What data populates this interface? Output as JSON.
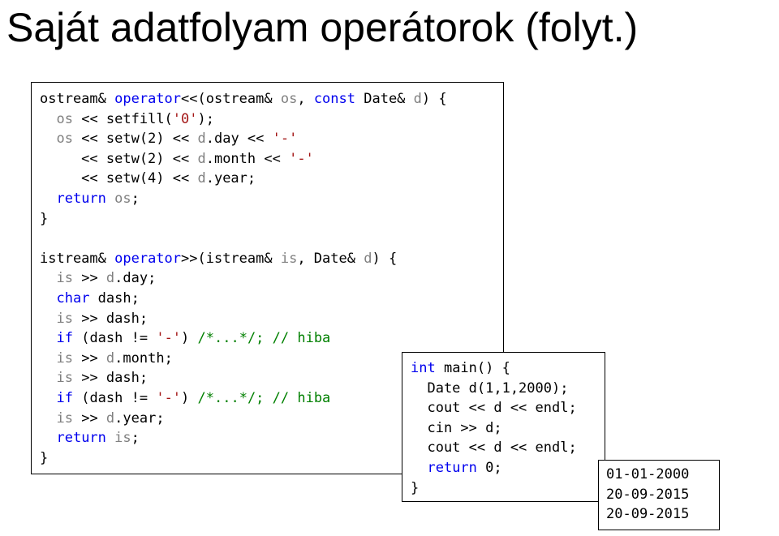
{
  "title": "Saját adatfolyam operátorok (folyt.)",
  "colors": {
    "keyword": "#0000ee",
    "parameter": "#808080",
    "string": "#a31515",
    "comment": "#008000",
    "text": "#000000"
  },
  "operators_code": [
    [
      {
        "t": "ostream& "
      },
      {
        "t": "operator",
        "c": "kw"
      },
      {
        "t": "<<(ostream& "
      },
      {
        "t": "os",
        "c": "param"
      },
      {
        "t": ", "
      },
      {
        "t": "const",
        "c": "kw"
      },
      {
        "t": " Date& "
      },
      {
        "t": "d",
        "c": "param"
      },
      {
        "t": ") {"
      }
    ],
    [
      {
        "t": "  "
      },
      {
        "t": "os",
        "c": "param"
      },
      {
        "t": " << setfill("
      },
      {
        "t": "'0'",
        "c": "str"
      },
      {
        "t": ");"
      }
    ],
    [
      {
        "t": "  "
      },
      {
        "t": "os",
        "c": "param"
      },
      {
        "t": " << setw(2) << "
      },
      {
        "t": "d",
        "c": "param"
      },
      {
        "t": ".day << "
      },
      {
        "t": "'-'",
        "c": "str"
      }
    ],
    [
      {
        "t": "     << setw(2) << "
      },
      {
        "t": "d",
        "c": "param"
      },
      {
        "t": ".month << "
      },
      {
        "t": "'-'",
        "c": "str"
      }
    ],
    [
      {
        "t": "     << setw(4) << "
      },
      {
        "t": "d",
        "c": "param"
      },
      {
        "t": ".year;"
      }
    ],
    [
      {
        "t": "  "
      },
      {
        "t": "return",
        "c": "kw"
      },
      {
        "t": " "
      },
      {
        "t": "os",
        "c": "param"
      },
      {
        "t": ";"
      }
    ],
    [
      {
        "t": "}"
      }
    ],
    [
      {
        "t": ""
      }
    ],
    [
      {
        "t": "istream& "
      },
      {
        "t": "operator",
        "c": "kw"
      },
      {
        "t": ">>(istream& "
      },
      {
        "t": "is",
        "c": "param"
      },
      {
        "t": ", Date& "
      },
      {
        "t": "d",
        "c": "param"
      },
      {
        "t": ") {"
      }
    ],
    [
      {
        "t": "  "
      },
      {
        "t": "is",
        "c": "param"
      },
      {
        "t": " >> "
      },
      {
        "t": "d",
        "c": "param"
      },
      {
        "t": ".day;"
      }
    ],
    [
      {
        "t": "  "
      },
      {
        "t": "char",
        "c": "kw"
      },
      {
        "t": " dash;"
      }
    ],
    [
      {
        "t": "  "
      },
      {
        "t": "is",
        "c": "param"
      },
      {
        "t": " >> dash;"
      }
    ],
    [
      {
        "t": "  "
      },
      {
        "t": "if",
        "c": "kw"
      },
      {
        "t": " (dash != "
      },
      {
        "t": "'-'",
        "c": "str"
      },
      {
        "t": ") "
      },
      {
        "t": "/*...*/; // hiba",
        "c": "cmt"
      }
    ],
    [
      {
        "t": "  "
      },
      {
        "t": "is",
        "c": "param"
      },
      {
        "t": " >> "
      },
      {
        "t": "d",
        "c": "param"
      },
      {
        "t": ".month;"
      }
    ],
    [
      {
        "t": "  "
      },
      {
        "t": "is",
        "c": "param"
      },
      {
        "t": " >> dash;"
      }
    ],
    [
      {
        "t": "  "
      },
      {
        "t": "if",
        "c": "kw"
      },
      {
        "t": " (dash != "
      },
      {
        "t": "'-'",
        "c": "str"
      },
      {
        "t": ") "
      },
      {
        "t": "/*...*/; // hiba",
        "c": "cmt"
      }
    ],
    [
      {
        "t": "  "
      },
      {
        "t": "is",
        "c": "param"
      },
      {
        "t": " >> "
      },
      {
        "t": "d",
        "c": "param"
      },
      {
        "t": ".year;"
      }
    ],
    [
      {
        "t": "  "
      },
      {
        "t": "return",
        "c": "kw"
      },
      {
        "t": " "
      },
      {
        "t": "is",
        "c": "param"
      },
      {
        "t": ";"
      }
    ],
    [
      {
        "t": "}"
      }
    ]
  ],
  "main_code": [
    [
      {
        "t": "int",
        "c": "kw"
      },
      {
        "t": " main() {"
      }
    ],
    [
      {
        "t": "  Date d(1,1,2000);"
      }
    ],
    [
      {
        "t": "  cout << d << endl;"
      }
    ],
    [
      {
        "t": "  cin >> d;"
      }
    ],
    [
      {
        "t": "  cout << d << endl;"
      }
    ],
    [
      {
        "t": "  "
      },
      {
        "t": "return",
        "c": "kw"
      },
      {
        "t": " 0;"
      }
    ],
    [
      {
        "t": "}"
      }
    ]
  ],
  "output_lines": [
    [
      {
        "t": "01-01-2000"
      }
    ],
    [
      {
        "t": "20-09-2015"
      }
    ],
    [
      {
        "t": "20-09-2015"
      }
    ]
  ]
}
